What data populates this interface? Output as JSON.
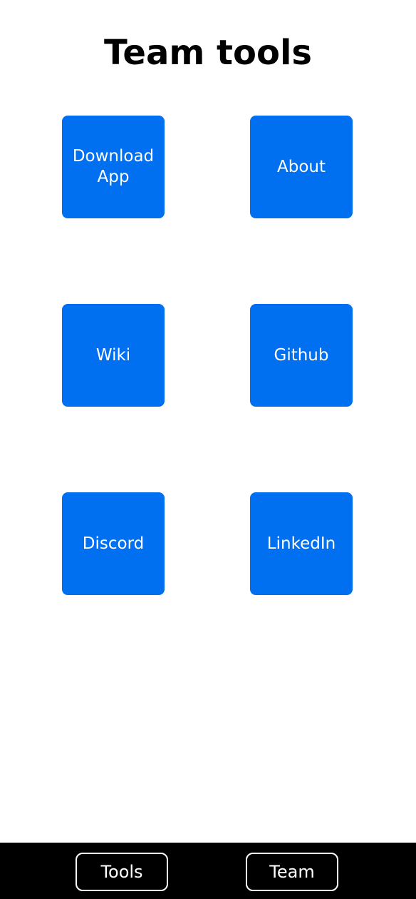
{
  "header": {
    "title": "Team tools"
  },
  "tiles": [
    {
      "label": "Download App"
    },
    {
      "label": "About"
    },
    {
      "label": "Wiki"
    },
    {
      "label": "Github"
    },
    {
      "label": "Discord"
    },
    {
      "label": "LinkedIn"
    }
  ],
  "bottom_nav": {
    "items": [
      {
        "label": "Tools"
      },
      {
        "label": "Team"
      }
    ]
  },
  "colors": {
    "tile_background": "#006ff0",
    "tile_text": "#ffffff",
    "nav_background": "#000000",
    "nav_text": "#ffffff",
    "page_background": "#ffffff"
  }
}
